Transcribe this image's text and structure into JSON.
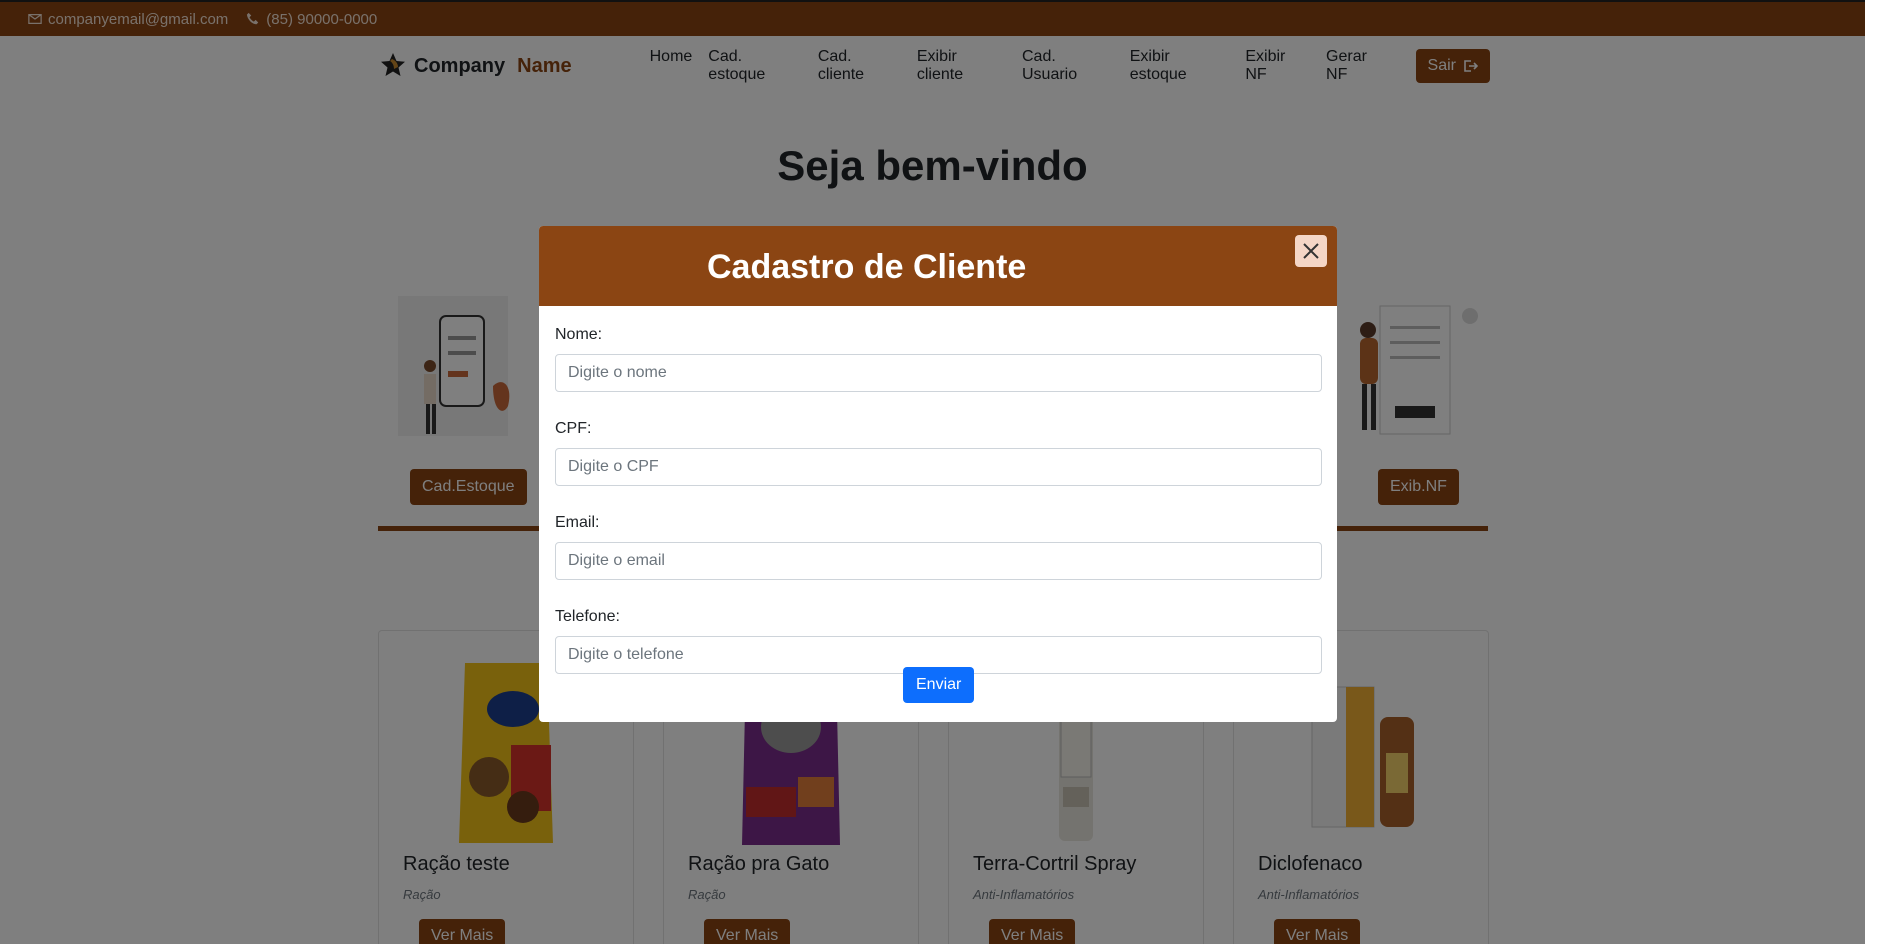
{
  "topbar": {
    "email": "companyemail@gmail.com",
    "phone": "(85) 90000-0000"
  },
  "brand": {
    "part1": "Company",
    "part2": "Name"
  },
  "nav": {
    "links": [
      "Home",
      "Cad. estoque",
      "Cad. cliente",
      "Exibir cliente",
      "Cad. Usuario",
      "Exibir estoque",
      "Exibir NF",
      "Gerar NF"
    ],
    "logout": "Sair"
  },
  "welcome": "Seja bem-vindo",
  "quick_buttons": {
    "left": "Cad.Estoque",
    "right": "Exib.NF"
  },
  "products": [
    {
      "name": "Ração teste",
      "category": "Ração",
      "button": "Ver Mais"
    },
    {
      "name": "Ração pra Gato",
      "category": "Ração",
      "button": "Ver Mais"
    },
    {
      "name": "Terra-Cortril Spray",
      "category": "Anti-Inflamatórios",
      "button": "Ver Mais"
    },
    {
      "name": "Diclofenaco",
      "category": "Anti-Inflamatórios",
      "button": "Ver Mais"
    }
  ],
  "modal": {
    "title": "Cadastro de Cliente",
    "fields": [
      {
        "label": "Nome:",
        "placeholder": "Digite o nome"
      },
      {
        "label": "CPF:",
        "placeholder": "Digite o CPF"
      },
      {
        "label": "Email:",
        "placeholder": "Digite o email"
      },
      {
        "label": "Telefone:",
        "placeholder": "Digite o telefone"
      }
    ],
    "submit": "Enviar"
  },
  "colors": {
    "primary_brown": "#8b4513",
    "submit_blue": "#0d6efd"
  }
}
